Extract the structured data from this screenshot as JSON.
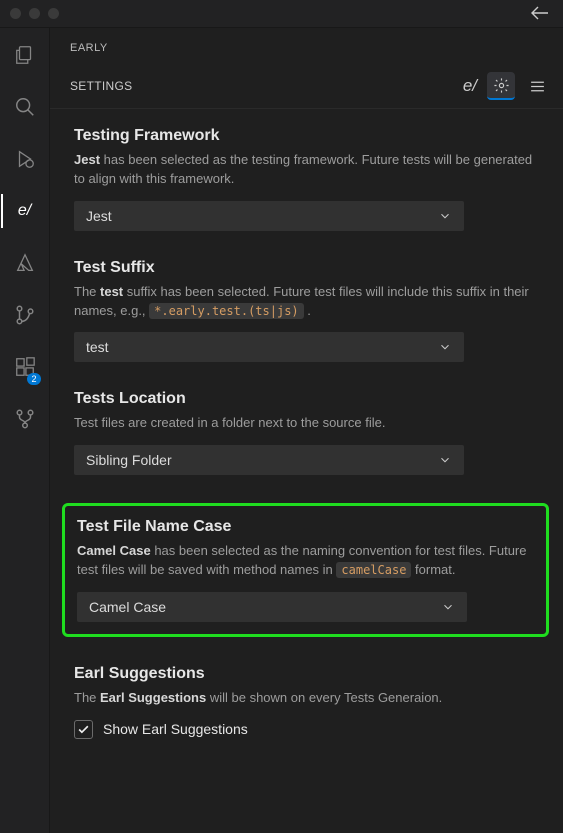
{
  "header": {
    "panel_title": "EARLY",
    "settings_label": "SETTINGS",
    "logo": "e/"
  },
  "activitybar": {
    "badge_count": "2",
    "active_label": "e/"
  },
  "sections": {
    "framework": {
      "title": "Testing Framework",
      "bold": "Jest",
      "desc_rest": " has been selected as the testing framework. Future tests will be generated to align with this framework.",
      "value": "Jest"
    },
    "suffix": {
      "title": "Test Suffix",
      "pre": "The ",
      "bold": "test",
      "mid": " suffix has been selected. Future test files will include this suffix in their names, e.g., ",
      "code": "*.early.test.(ts|js)",
      "post": " .",
      "value": "test"
    },
    "location": {
      "title": "Tests Location",
      "desc": "Test files are created in a folder next to the source file.",
      "value": "Sibling Folder"
    },
    "filecase": {
      "title": "Test File Name Case",
      "bold": "Camel Case",
      "mid": " has been selected as the naming convention for test files. Future test files will be saved with method names in ",
      "code": "camelCase",
      "post": " format.",
      "value": "Camel Case"
    },
    "suggestions": {
      "title": "Earl Suggestions",
      "pre": "The ",
      "bold": "Earl Suggestions",
      "post": " will be shown on every Tests Generaion.",
      "checkbox_label": "Show Earl Suggestions"
    }
  }
}
